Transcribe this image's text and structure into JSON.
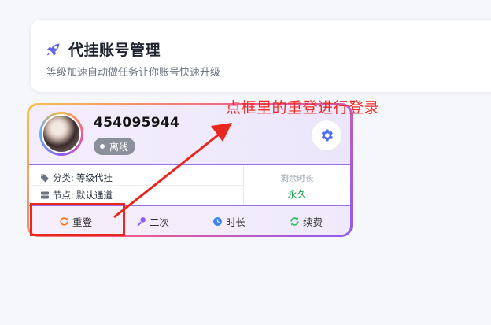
{
  "header": {
    "title": "代挂账号管理",
    "subtitle": "等级加速自动做任务让你账号快速升级",
    "icon": "rocket-icon"
  },
  "account": {
    "id": "454095944",
    "status": "离线",
    "category_label": "分类:",
    "category_value": "等级代挂",
    "node_label": "节点:",
    "node_value": "默认通道",
    "remaining_label": "剩余时长",
    "remaining_value": "永久"
  },
  "actions": [
    {
      "label": "重登",
      "icon": "refresh-icon",
      "color": "#f97316"
    },
    {
      "label": "二次",
      "icon": "key-icon",
      "color": "#8b5cf6"
    },
    {
      "label": "时长",
      "icon": "clock-icon",
      "color": "#3b82f6"
    },
    {
      "label": "续费",
      "icon": "renew-icon",
      "color": "#22c55e"
    }
  ],
  "annotation": {
    "text": "点框里的重登进行登录",
    "color": "#ef2a23"
  }
}
